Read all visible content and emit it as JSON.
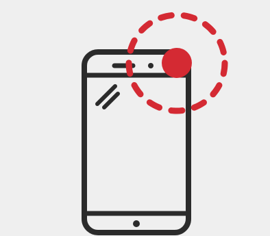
{
  "illustration": {
    "subject": "smartphone-icon",
    "indicator": "notification-dot-icon",
    "indicator_ring": "dashed-ring-icon"
  },
  "colors": {
    "background": "#efefef",
    "phone_outline": "#2b2b2b",
    "accent": "#d42a33"
  }
}
